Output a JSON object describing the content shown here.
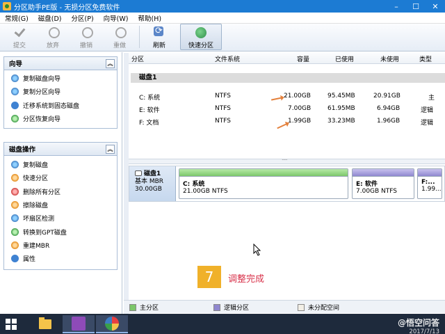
{
  "window": {
    "title": "分区助手PE版 - 无损分区免费软件",
    "controls": [
      "–",
      "☐",
      "✕"
    ]
  },
  "menu": [
    "常规(G)",
    "磁盘(D)",
    "分区(P)",
    "向导(W)",
    "帮助(H)"
  ],
  "toolbar": {
    "commit": "提交",
    "discard": "放弃",
    "undo": "撤销",
    "redo": "重做",
    "refresh": "刷新",
    "quick_partition": "快速分区"
  },
  "wizard": {
    "title": "向导",
    "items": [
      "复制磁盘向导",
      "复制分区向导",
      "迁移系统到固态磁盘",
      "分区恢复向导"
    ]
  },
  "disk_ops": {
    "title": "磁盘操作",
    "items": [
      "复制磁盘",
      "快速分区",
      "删除所有分区",
      "擦除磁盘",
      "坏扇区检测",
      "转换到GPT磁盘",
      "重建MBR",
      "属性"
    ]
  },
  "grid": {
    "headers": [
      "分区",
      "文件系统",
      "容量",
      "已使用",
      "未使用",
      "类型"
    ],
    "disk_label": "磁盘1",
    "rows": [
      {
        "name": "C: 系统",
        "fs": "NTFS",
        "capacity": "21.00GB",
        "used": "95.45MB",
        "free": "20.91GB",
        "type": "主"
      },
      {
        "name": "E: 软件",
        "fs": "NTFS",
        "capacity": "7.00GB",
        "used": "61.95MB",
        "free": "6.94GB",
        "type": "逻辑"
      },
      {
        "name": "F: 文档",
        "fs": "NTFS",
        "capacity": "1.99GB",
        "used": "33.23MB",
        "free": "1.96GB",
        "type": "逻辑"
      }
    ]
  },
  "diskmap": {
    "name": "磁盘1",
    "kind": "基本 MBR",
    "size": "30.00GB",
    "partitions": [
      {
        "name": "C: 系统",
        "detail": "21.00GB NTFS"
      },
      {
        "name": "E: 软件",
        "detail": "7.00GB NTFS"
      },
      {
        "name": "F:...",
        "detail": "1.99..."
      }
    ]
  },
  "step": {
    "number": "7",
    "text": "调整完成"
  },
  "legend": [
    "主分区",
    "逻辑分区",
    "未分配空间"
  ],
  "tray": {
    "watermark": "@悟空问答",
    "date": "2017/7/13"
  }
}
